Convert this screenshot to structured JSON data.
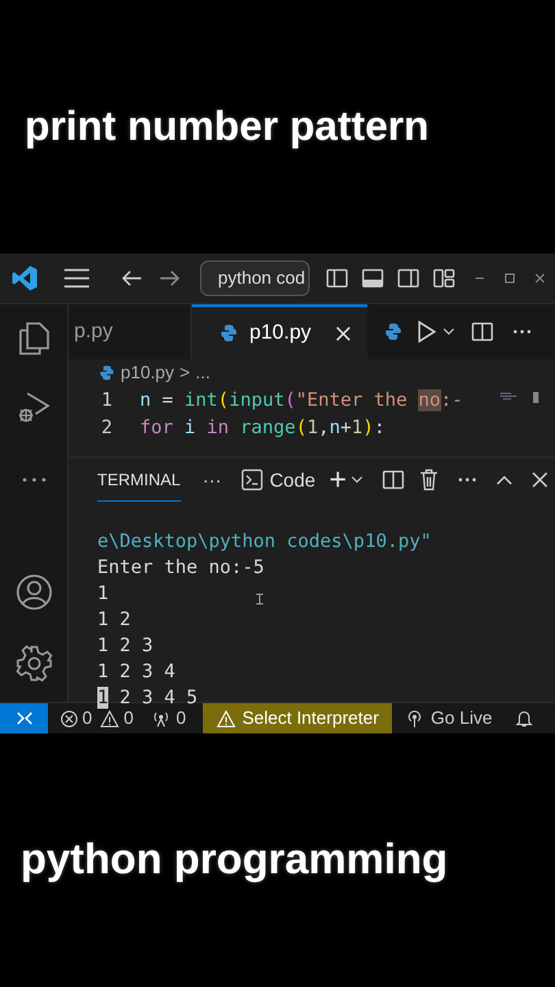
{
  "captions": {
    "top": "print number pattern",
    "bottom": "python programming"
  },
  "title_bar": {
    "search": "python cod"
  },
  "tabs": [
    {
      "label": "p.py",
      "selected": false
    },
    {
      "label": "p10.py",
      "selected": true
    }
  ],
  "breadcrumb": {
    "file": "p10.py",
    "separator": ">",
    "more": "..."
  },
  "code_lines": [
    {
      "number": "1",
      "tokens": [
        {
          "kind": "variable",
          "text": "n"
        },
        {
          "kind": "plain",
          "text": " = "
        },
        {
          "kind": "function",
          "text": "int"
        },
        {
          "kind": "bracket",
          "text": "("
        },
        {
          "kind": "function",
          "text": "input"
        },
        {
          "kind": "bracket2",
          "text": "("
        },
        {
          "kind": "string",
          "text": "\"Enter the "
        },
        {
          "kind": "match",
          "text": "no"
        },
        {
          "kind": "string",
          "text": ":-"
        }
      ]
    },
    {
      "number": "2",
      "tokens": [
        {
          "kind": "keyword",
          "text": "for"
        },
        {
          "kind": "variable",
          "text": " i"
        },
        {
          "kind": "keyword",
          "text": " in"
        },
        {
          "kind": "function",
          "text": " range"
        },
        {
          "kind": "bracket",
          "text": "("
        },
        {
          "kind": "number",
          "text": "1"
        },
        {
          "kind": "plain",
          "text": ","
        },
        {
          "kind": "variable",
          "text": "n"
        },
        {
          "kind": "plain",
          "text": "+"
        },
        {
          "kind": "number",
          "text": "1"
        },
        {
          "kind": "bracket",
          "text": ")"
        },
        {
          "kind": "plain",
          "text": ":"
        }
      ]
    }
  ],
  "panel": {
    "tab": "TERMINAL",
    "more": "···",
    "shell": "Code",
    "plus": "+"
  },
  "terminal_lines": [
    {
      "kind": "path",
      "text": "e\\Desktop\\python codes\\p10.py\""
    },
    {
      "kind": "output",
      "text": "Enter the no:-5"
    },
    {
      "kind": "output",
      "text": "1"
    },
    {
      "kind": "output",
      "text": "1 2"
    },
    {
      "kind": "output",
      "text": "1 2 3"
    },
    {
      "kind": "output",
      "text": "1 2 3 4"
    },
    {
      "kind": "output",
      "text": "1 2 3 4 5",
      "cursor": true
    }
  ],
  "status_bar": {
    "errors": "0",
    "warnings": "0",
    "ports": "0",
    "interpreter": "Select Interpreter",
    "live": "Go Live"
  }
}
